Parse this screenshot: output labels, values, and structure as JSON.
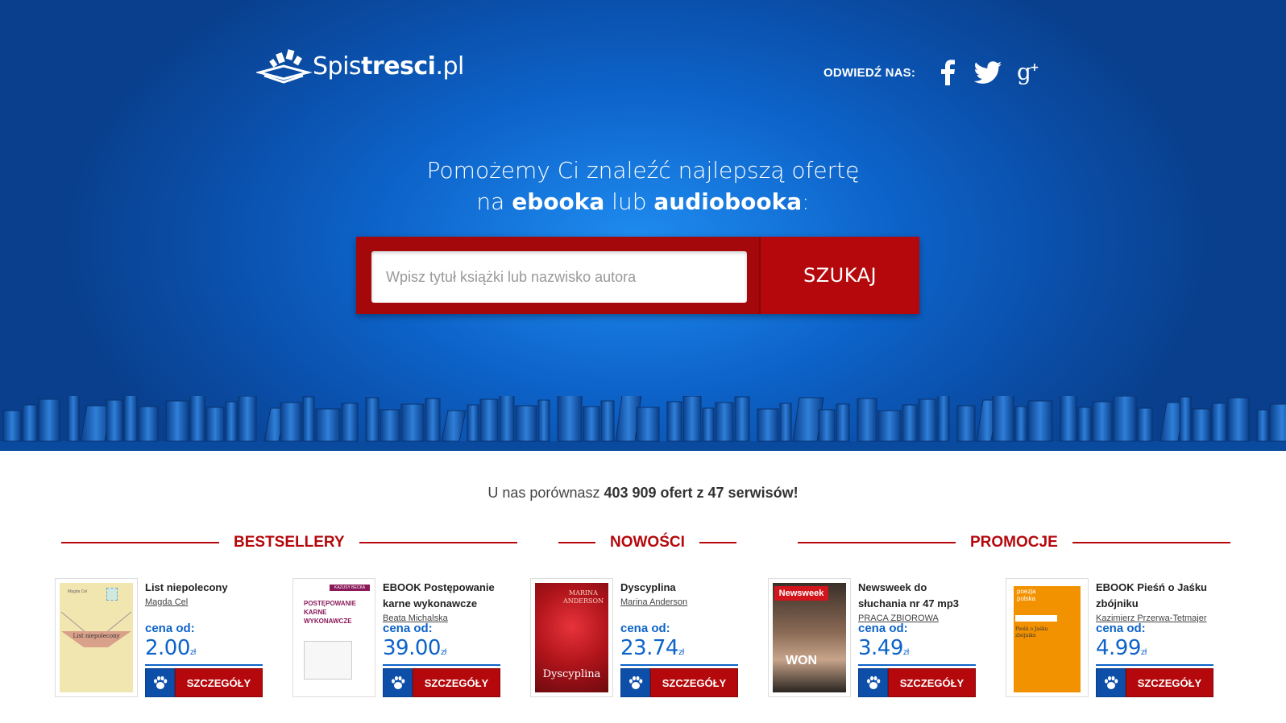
{
  "header": {
    "logo_prefix": "Spis",
    "logo_bold": "tresci",
    "logo_suffix": ".pl",
    "social_label": "ODWIEDŹ NAS:",
    "social_icons": [
      "facebook-icon",
      "twitter-icon",
      "google-plus-icon"
    ]
  },
  "hero": {
    "line1": "Pomożemy Ci znaleźć najlepszą ofertę",
    "line2_pre": "na ",
    "line2_b1": "ebooka",
    "line2_mid": " lub ",
    "line2_b2": "audiobooka",
    "line2_post": ":",
    "search_placeholder": "Wpisz tytuł książki lub nazwisko autora",
    "search_button": "SZUKAJ"
  },
  "stats": {
    "pre": "U nas porównasz ",
    "bold": "403 909 ofert z 47 serwisów!"
  },
  "sections": {
    "bestsellery": "BESTSELLERY",
    "nowosci": "NOWOŚCI",
    "promocje": "PROMOCJE"
  },
  "cards": {
    "price_label": "cena od:",
    "currency": "zł",
    "details_label": "SZCZEGÓŁY",
    "items": [
      {
        "title": "List niepolecony",
        "author": "Magda Cel",
        "price": "2.00",
        "cover_text": "List niepolecony",
        "cover_small": "Magda Cel"
      },
      {
        "title": "EBOOK Postępowanie karne wykonawcze",
        "author": "Beata Michalska",
        "price": "39.00",
        "cover_text": "POSTĘPOWANIE KARNE WYKONAWCZE",
        "cover_small": "KAZUSY BECKA"
      },
      {
        "title": "Dyscyplina",
        "author": "Marina Anderson",
        "price": "23.74",
        "cover_text": "Dyscyplina",
        "cover_small": "MARINA ANDERSON"
      },
      {
        "title": "Newsweek do słuchania nr 47 mp3",
        "author": "PRACA ZBIOROWA",
        "price": "3.49",
        "cover_text": "WON",
        "cover_small": "Newsweek"
      },
      {
        "title": "EBOOK Pieśń o Jaśku zbójniku",
        "author": "Kazimierz Przerwa-Tetmajer",
        "price": "4.99",
        "cover_text": "Pieśń o Jaśku zbójniku",
        "cover_small": "poezja polska"
      }
    ]
  },
  "colors": {
    "brand_blue": "#0d63c9",
    "brand_red": "#b5080c"
  }
}
